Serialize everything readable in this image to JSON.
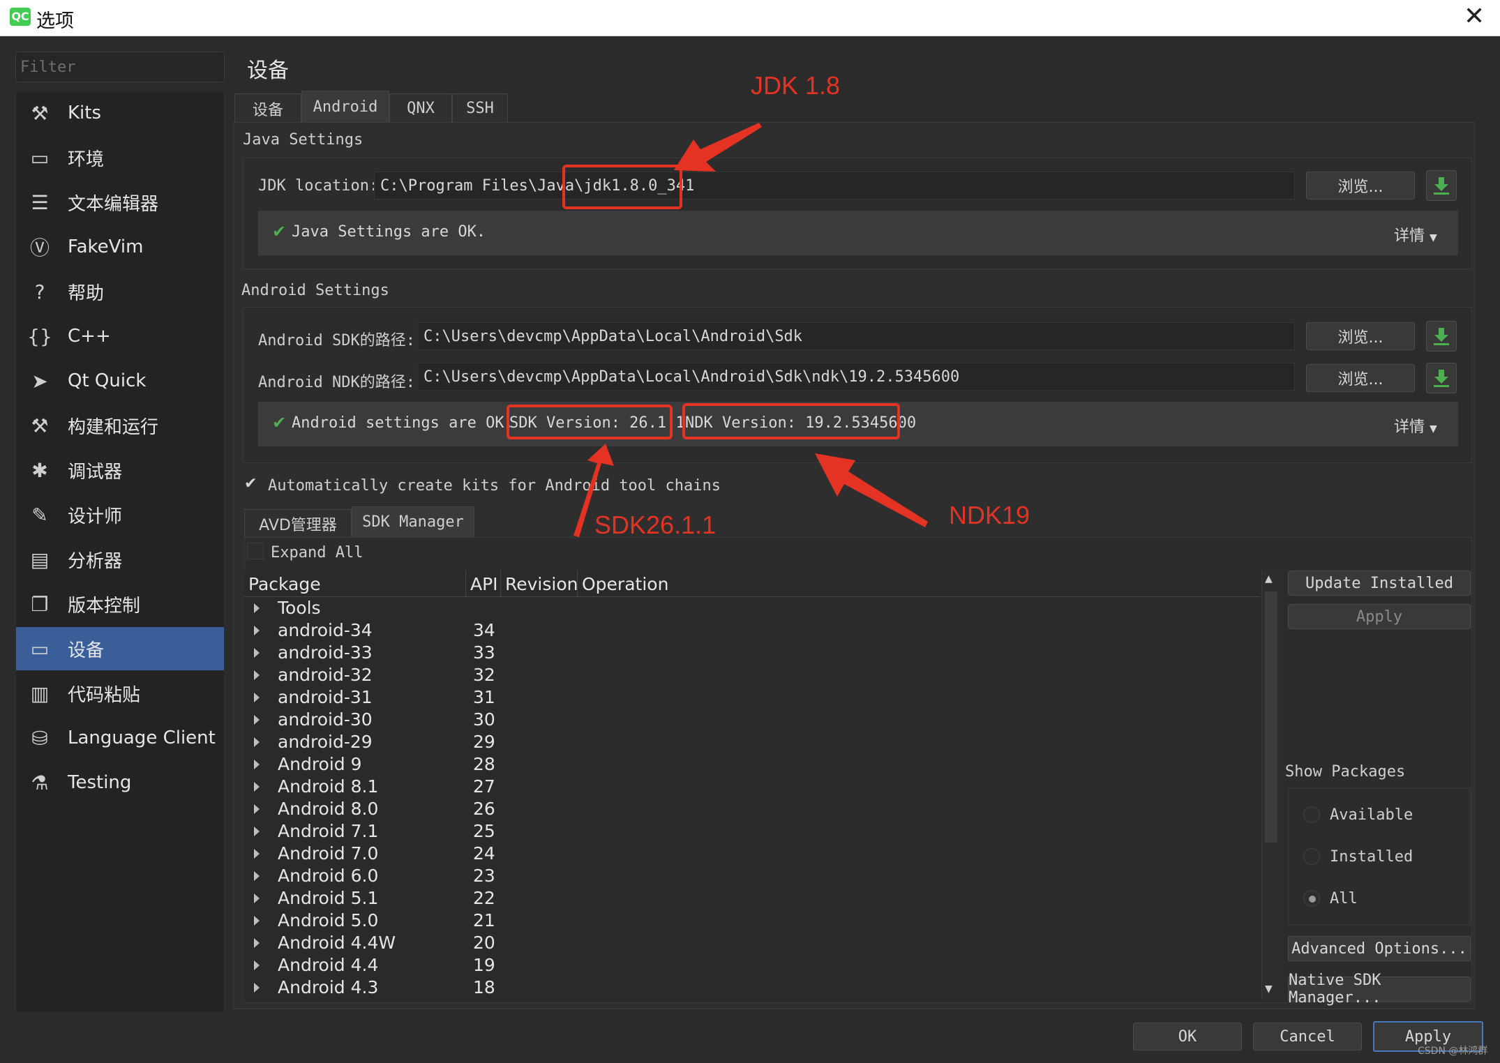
{
  "window": {
    "title": "选项",
    "app_icon": "QC"
  },
  "sidebar": {
    "filter_placeholder": "Filter",
    "items": [
      {
        "label": "Kits",
        "icon": "kits-icon"
      },
      {
        "label": "环境",
        "icon": "monitor-icon"
      },
      {
        "label": "文本编辑器",
        "icon": "text-editor-icon"
      },
      {
        "label": "FakeVim",
        "icon": "fakevim-icon"
      },
      {
        "label": "帮助",
        "icon": "help-icon"
      },
      {
        "label": "C++",
        "icon": "braces-icon"
      },
      {
        "label": "Qt Quick",
        "icon": "paper-plane-icon"
      },
      {
        "label": "构建和运行",
        "icon": "hammer-icon"
      },
      {
        "label": "调试器",
        "icon": "bug-icon"
      },
      {
        "label": "设计师",
        "icon": "pencil-icon"
      },
      {
        "label": "分析器",
        "icon": "analyzer-icon"
      },
      {
        "label": "版本控制",
        "icon": "version-control-icon"
      },
      {
        "label": "设备",
        "icon": "devices-icon"
      },
      {
        "label": "代码粘贴",
        "icon": "clipboard-icon"
      },
      {
        "label": "Language Client",
        "icon": "language-client-icon"
      },
      {
        "label": "Testing",
        "icon": "testing-icon"
      }
    ],
    "selected": "设备"
  },
  "page": {
    "title": "设备",
    "tabs": [
      "设备",
      "Android",
      "QNX",
      "SSH"
    ],
    "selected_tab": "Android"
  },
  "java": {
    "section": "Java Settings",
    "jdk_label": "JDK location:",
    "jdk_value": "C:\\Program Files\\Java\\jdk1.8.0_341",
    "browse": "浏览...",
    "status": "Java Settings are OK.",
    "details": "详情"
  },
  "android": {
    "section": "Android Settings",
    "sdk_label": "Android SDK的路径:",
    "sdk_value": "C:\\Users\\devcmp\\AppData\\Local\\Android\\Sdk",
    "ndk_label": "Android NDK的路径:",
    "ndk_value": "C:\\Users\\devcmp\\AppData\\Local\\Android\\Sdk\\ndk\\19.2.5345600",
    "browse": "浏览...",
    "status": "Android settings are OK.",
    "sdk_version": "SDK Version: 26.1.1",
    "ndk_version": "NDK Version: 19.2.5345600",
    "details": "详情",
    "auto_kits": "Automatically create kits for Android tool chains",
    "auto_kits_checked": true
  },
  "subtabs": [
    "AVD管理器",
    "SDK Manager"
  ],
  "selected_subtab": "SDK Manager",
  "sdk_manager": {
    "expand_all": "Expand All",
    "columns": [
      "Package",
      "API",
      "Revision",
      "Operation"
    ],
    "rows": [
      {
        "pkg": "Tools",
        "api": ""
      },
      {
        "pkg": "android-34",
        "api": "34"
      },
      {
        "pkg": "android-33",
        "api": "33"
      },
      {
        "pkg": "android-32",
        "api": "32"
      },
      {
        "pkg": "android-31",
        "api": "31"
      },
      {
        "pkg": "android-30",
        "api": "30"
      },
      {
        "pkg": "android-29",
        "api": "29"
      },
      {
        "pkg": "Android 9",
        "api": "28"
      },
      {
        "pkg": "Android 8.1",
        "api": "27"
      },
      {
        "pkg": "Android 8.0",
        "api": "26"
      },
      {
        "pkg": "Android 7.1",
        "api": "25"
      },
      {
        "pkg": "Android 7.0",
        "api": "24"
      },
      {
        "pkg": "Android 6.0",
        "api": "23"
      },
      {
        "pkg": "Android 5.1",
        "api": "22"
      },
      {
        "pkg": "Android 5.0",
        "api": "21"
      },
      {
        "pkg": "Android 4.4W",
        "api": "20"
      },
      {
        "pkg": "Android 4.4",
        "api": "19"
      },
      {
        "pkg": "Android 4.3",
        "api": "18"
      }
    ],
    "update_installed": "Update Installed",
    "apply": "Apply",
    "show_packages": "Show Packages",
    "filters": [
      "Available",
      "Installed",
      "All"
    ],
    "selected_filter": "All",
    "advanced_options": "Advanced Options...",
    "native_sdk_manager": "Native SDK Manager..."
  },
  "footer": {
    "ok": "OK",
    "cancel": "Cancel",
    "apply": "Apply",
    "watermark": "CSDN @林鸿群"
  },
  "annotations": {
    "jdk": "JDK 1.8",
    "sdk": "SDK26.1.1",
    "ndk": "NDK19",
    "color": "#e53323"
  }
}
